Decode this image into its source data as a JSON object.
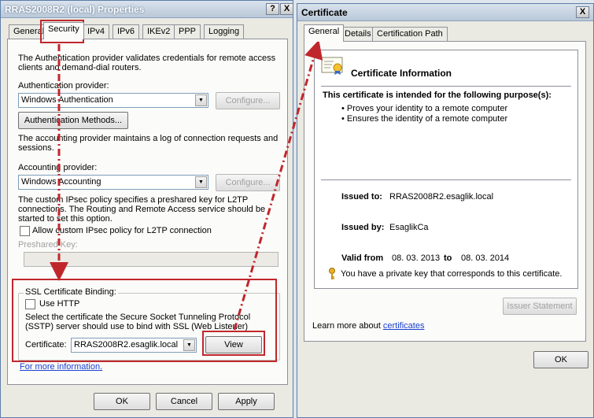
{
  "left_window": {
    "title": "RRAS2008R2 (local) Properties",
    "help_button": "?",
    "close_button": "X",
    "tabs": [
      "General",
      "Security",
      "IPv4",
      "IPv6",
      "IKEv2",
      "PPP",
      "Logging"
    ],
    "active_tab": "Security",
    "auth_description": "The Authentication provider validates credentials for remote access clients and demand-dial routers.",
    "auth_provider_label": "Authentication provider:",
    "auth_provider_value": "Windows Authentication",
    "configure_label": "Configure...",
    "auth_methods_button": "Authentication Methods...",
    "accounting_description": "The accounting provider maintains a log of connection requests and sessions.",
    "accounting_provider_label": "Accounting provider:",
    "accounting_provider_value": "Windows Accounting",
    "ipsec_description": "The custom IPsec policy specifies a preshared key for L2TP connections. The Routing and Remote Access service should be started to set this option.",
    "ipsec_checkbox_label": "Allow custom IPsec policy for L2TP connection",
    "preshared_key_label": "Preshared Key:",
    "ssl_group_label": "SSL Certificate Binding:",
    "use_http_label": "Use HTTP",
    "sstp_description": "Select the certificate the Secure Socket Tunneling Protocol (SSTP) server should use to bind with SSL (Web Listener)",
    "certificate_label": "Certificate:",
    "certificate_value": "RRAS2008R2.esaglik.local",
    "view_button": "View",
    "more_info_link": "For more information.",
    "ok_button": "OK",
    "cancel_button": "Cancel",
    "apply_button": "Apply"
  },
  "right_window": {
    "title": "Certificate",
    "close_button": "X",
    "tabs": [
      "General",
      "Details",
      "Certification Path"
    ],
    "active_tab": "General",
    "info_title": "Certificate Information",
    "purpose_heading": "This certificate is intended for the following purpose(s):",
    "purposes": [
      "Proves your identity to a remote computer",
      "Ensures the identity of a remote computer"
    ],
    "issued_to_label": "Issued to:",
    "issued_to_value": "RRAS2008R2.esaglik.local",
    "issued_by_label": "Issued by:",
    "issued_by_value": "EsaglikCa",
    "valid_from_label": "Valid from",
    "valid_from_value": "08. 03. 2013",
    "valid_to_label": "to",
    "valid_to_value": "08. 03. 2014",
    "private_key_text": "You have a private key that corresponds to this certificate.",
    "issuer_statement_button": "Issuer Statement",
    "learn_more_text": "Learn more about",
    "learn_more_link": "certificates",
    "ok_button": "OK"
  },
  "colors": {
    "annotation_red": "#c0272d",
    "link_blue": "#1a3fd1",
    "title_bar": "#b9c8d8"
  },
  "icons": [
    "certificate-icon",
    "key-icon",
    "help-icon",
    "close-icon",
    "dropdown-arrow-icon"
  ]
}
